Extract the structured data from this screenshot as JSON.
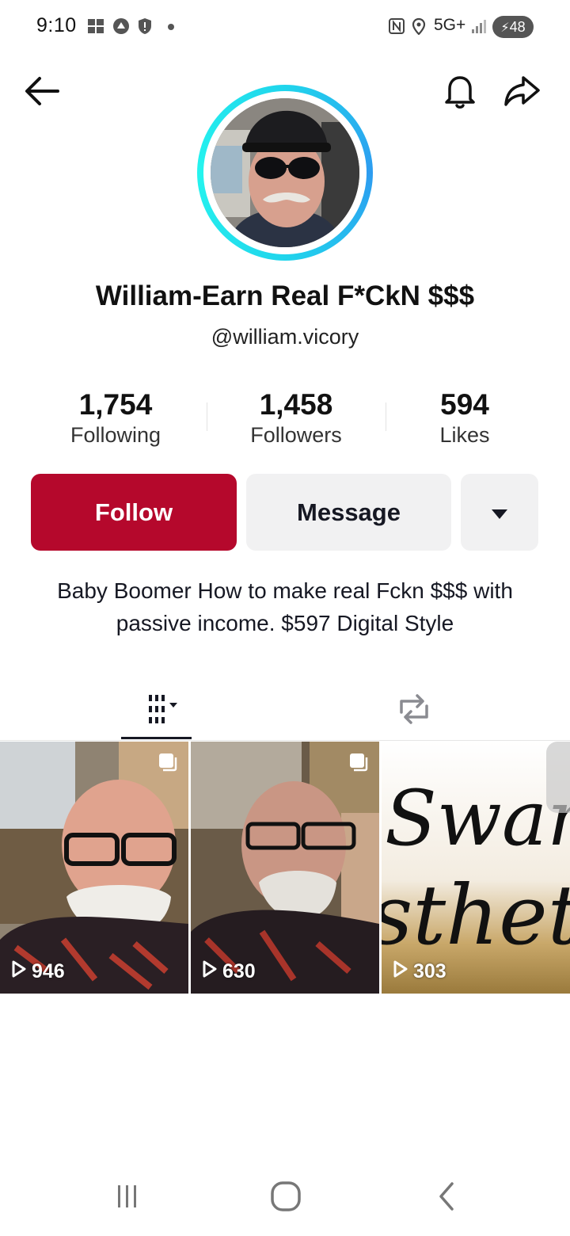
{
  "status_bar": {
    "time": "9:10",
    "network": "5G+",
    "battery": "48",
    "icons": [
      "notification-icon",
      "app-icon",
      "shield-icon",
      "dot-icon",
      "nfc-icon",
      "location-icon",
      "signal-icon",
      "battery-icon"
    ]
  },
  "header": {
    "back_icon": "back-arrow-icon",
    "bell_icon": "bell-icon",
    "share_icon": "share-icon"
  },
  "profile": {
    "display_name": "William-Earn Real F*CkN $$$",
    "username": "@william.vicory",
    "bio": "Baby Boomer How to make real Fckn $$$ with passive income. $597 Digital Style"
  },
  "stats": [
    {
      "value": "1,754",
      "label": "Following"
    },
    {
      "value": "1,458",
      "label": "Followers"
    },
    {
      "value": "594",
      "label": "Likes"
    }
  ],
  "actions": {
    "follow_label": "Follow",
    "message_label": "Message",
    "more_icon": "caret-down-icon"
  },
  "tabs": [
    {
      "icon": "videos-grid-icon",
      "active": true
    },
    {
      "icon": "repost-icon",
      "active": false
    }
  ],
  "videos": [
    {
      "views": "946"
    },
    {
      "views": "630"
    },
    {
      "views": "303",
      "thumb_text": "Swank\nstheti"
    }
  ],
  "colors": {
    "follow_button": "#b5082c",
    "secondary_button": "#f1f1f2",
    "avatar_ring": "#20d5ec"
  }
}
